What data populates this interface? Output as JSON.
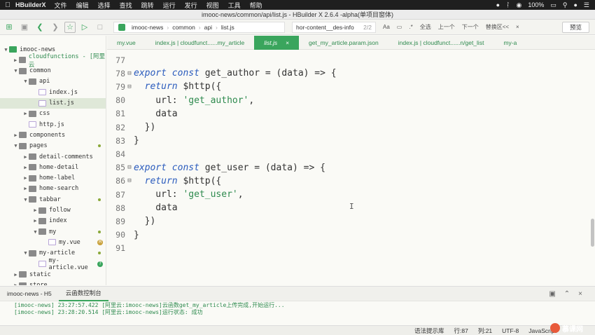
{
  "menubar": {
    "app_name": "HBuilderX",
    "items": [
      "文件",
      "编辑",
      "选择",
      "查找",
      "跳转",
      "运行",
      "发行",
      "视图",
      "工具",
      "帮助"
    ],
    "battery": "100%"
  },
  "window_title": "imooc-news/common/api/list.js - HBuilder X 2.6.4 -alpha(单项目窗体)",
  "toolbar": {
    "breadcrumb": [
      "imooc-news",
      "common",
      "api",
      "list.js"
    ],
    "find_text": "hor-content__des-info",
    "find_count": "2/2",
    "select_all": "全选",
    "prev": "上一个",
    "next": "下一个",
    "replace_area": "替换区<<",
    "preview_label": "预览"
  },
  "sidebar": {
    "items": [
      {
        "label": "imooc-news",
        "depth": 0,
        "type": "project",
        "open": true
      },
      {
        "label": "cloudfunctions - [阿里云",
        "depth": 1,
        "type": "folder",
        "open": false,
        "cloud": true
      },
      {
        "label": "common",
        "depth": 1,
        "type": "folder",
        "open": true
      },
      {
        "label": "api",
        "depth": 2,
        "type": "folder",
        "open": true
      },
      {
        "label": "index.js",
        "depth": 3,
        "type": "file"
      },
      {
        "label": "list.js",
        "depth": 3,
        "type": "file",
        "selected": true
      },
      {
        "label": "css",
        "depth": 2,
        "type": "folder",
        "open": false
      },
      {
        "label": "http.js",
        "depth": 2,
        "type": "file"
      },
      {
        "label": "components",
        "depth": 1,
        "type": "folder",
        "open": false
      },
      {
        "label": "pages",
        "depth": 1,
        "type": "folder",
        "open": true,
        "dot": true
      },
      {
        "label": "detail-comments",
        "depth": 2,
        "type": "folder",
        "open": false
      },
      {
        "label": "home-detail",
        "depth": 2,
        "type": "folder",
        "open": false
      },
      {
        "label": "home-label",
        "depth": 2,
        "type": "folder",
        "open": false
      },
      {
        "label": "home-search",
        "depth": 2,
        "type": "folder",
        "open": false
      },
      {
        "label": "tabbar",
        "depth": 2,
        "type": "folder",
        "open": true,
        "dot": true
      },
      {
        "label": "follow",
        "depth": 3,
        "type": "folder",
        "open": false
      },
      {
        "label": "index",
        "depth": 3,
        "type": "folder",
        "open": false
      },
      {
        "label": "my",
        "depth": 3,
        "type": "folder",
        "open": true,
        "dot": true
      },
      {
        "label": "my.vue",
        "depth": 4,
        "type": "file",
        "badge": "M"
      },
      {
        "label": "my-article",
        "depth": 2,
        "type": "folder",
        "open": true,
        "dot": true
      },
      {
        "label": "my-article.vue",
        "depth": 3,
        "type": "file",
        "badge": "?"
      },
      {
        "label": "static",
        "depth": 1,
        "type": "folder",
        "open": false
      },
      {
        "label": "store",
        "depth": 1,
        "type": "folder",
        "open": false
      }
    ]
  },
  "tabs": [
    {
      "label": "my.vue",
      "active": false
    },
    {
      "label": "index.js | cloudfunct......my_article",
      "active": false
    },
    {
      "label": "list.js",
      "active": true
    },
    {
      "label": "get_my_article.param.json",
      "active": false
    },
    {
      "label": "index.js | cloudfunct......n/get_list",
      "active": false
    },
    {
      "label": "my-a",
      "active": false
    }
  ],
  "editor": {
    "lines": [
      {
        "n": "77",
        "fold": false,
        "html": ""
      },
      {
        "n": "78",
        "fold": true,
        "html": "<span class='kw'>export</span> <span class='kw'>const</span> get_author = (data) => {"
      },
      {
        "n": "79",
        "fold": true,
        "html": "  <span class='kw'>return</span> $http({"
      },
      {
        "n": "80",
        "fold": false,
        "html": "    url: <span class='str'>'get_author'</span>,"
      },
      {
        "n": "81",
        "fold": false,
        "html": "    data"
      },
      {
        "n": "82",
        "fold": false,
        "html": "  })"
      },
      {
        "n": "83",
        "fold": false,
        "html": "}"
      },
      {
        "n": "84",
        "fold": false,
        "html": ""
      },
      {
        "n": "85",
        "fold": true,
        "html": "<span class='kw'>export</span> <span class='kw'>const</span> get_user = (data) => {"
      },
      {
        "n": "86",
        "fold": true,
        "html": "  <span class='kw'>return</span> $http({"
      },
      {
        "n": "87",
        "fold": false,
        "html": "    url: <span class='str'>'get_user'</span>,"
      },
      {
        "n": "88",
        "fold": false,
        "html": "    data"
      },
      {
        "n": "89",
        "fold": false,
        "html": "  })"
      },
      {
        "n": "90",
        "fold": false,
        "html": "}"
      },
      {
        "n": "91",
        "fold": false,
        "html": ""
      }
    ]
  },
  "console_tabs": [
    "imooc-news - H5",
    "云函数控制台"
  ],
  "console_lines": [
    "[imooc-news] 23:27:57.422 [阿里云:imooc-news]云函数get_my_article上传完成,开始运行...",
    "[imooc-news] 23:28:20.514 [阿里云:imooc-news]运行状态: 成功"
  ],
  "statusbar": {
    "hint": "语法提示库",
    "row": "行:87",
    "col": "列:21",
    "encoding": "UTF-8",
    "language": "JavaScript"
  },
  "watermark": "慕课网"
}
